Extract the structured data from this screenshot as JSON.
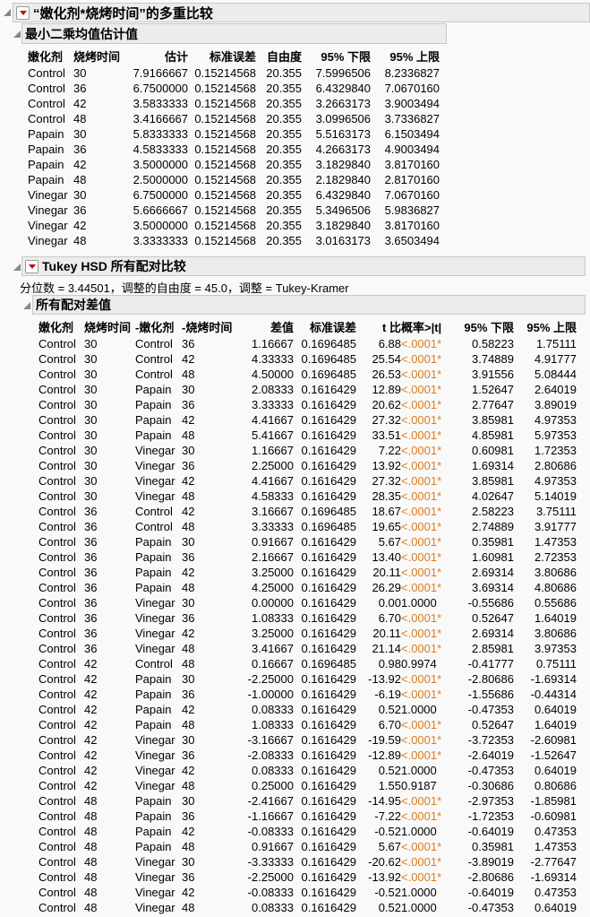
{
  "outline_title": "“嫩化剂*烧烤时间”的多重比较",
  "lsmeans": {
    "title": "最小二乘均值估计值",
    "headers": [
      "嫩化剂",
      "烧烤时间",
      "估计",
      "标准误差",
      "自由度",
      "95% 下限",
      "95% 上限"
    ],
    "rows": [
      [
        "Control",
        "30",
        "7.9166667",
        "0.15214568",
        "20.355",
        "7.5996506",
        "8.2336827"
      ],
      [
        "Control",
        "36",
        "6.7500000",
        "0.15214568",
        "20.355",
        "6.4329840",
        "7.0670160"
      ],
      [
        "Control",
        "42",
        "3.5833333",
        "0.15214568",
        "20.355",
        "3.2663173",
        "3.9003494"
      ],
      [
        "Control",
        "48",
        "3.4166667",
        "0.15214568",
        "20.355",
        "3.0996506",
        "3.7336827"
      ],
      [
        "Papain",
        "30",
        "5.8333333",
        "0.15214568",
        "20.355",
        "5.5163173",
        "6.1503494"
      ],
      [
        "Papain",
        "36",
        "4.5833333",
        "0.15214568",
        "20.355",
        "4.2663173",
        "4.9003494"
      ],
      [
        "Papain",
        "42",
        "3.5000000",
        "0.15214568",
        "20.355",
        "3.1829840",
        "3.8170160"
      ],
      [
        "Papain",
        "48",
        "2.5000000",
        "0.15214568",
        "20.355",
        "2.1829840",
        "2.8170160"
      ],
      [
        "Vinegar",
        "30",
        "6.7500000",
        "0.15214568",
        "20.355",
        "6.4329840",
        "7.0670160"
      ],
      [
        "Vinegar",
        "36",
        "5.6666667",
        "0.15214568",
        "20.355",
        "5.3496506",
        "5.9836827"
      ],
      [
        "Vinegar",
        "42",
        "3.5000000",
        "0.15214568",
        "20.355",
        "3.1829840",
        "3.8170160"
      ],
      [
        "Vinegar",
        "48",
        "3.3333333",
        "0.15214568",
        "20.355",
        "3.0163173",
        "3.6503494"
      ]
    ]
  },
  "tukey": {
    "title": "Tukey HSD 所有配对比较",
    "info": "分位数 = 3.44501，调整的自由度 = 45.0，调整 = Tukey-Kramer",
    "sub_title": "所有配对差值",
    "headers": [
      "嫩化剂",
      "烧烤时间",
      "-嫩化剂",
      "-烧烤时间",
      "差值",
      "标准误差",
      "t 比",
      "概率>|t|",
      "95% 下限",
      "95% 上限"
    ],
    "sig_color": "#e07b1e",
    "rows": [
      [
        "Control",
        "30",
        "Control",
        "36",
        "1.16667",
        "0.1696485",
        "6.88",
        "<.0001*",
        "0.58223",
        "1.75111"
      ],
      [
        "Control",
        "30",
        "Control",
        "42",
        "4.33333",
        "0.1696485",
        "25.54",
        "<.0001*",
        "3.74889",
        "4.91777"
      ],
      [
        "Control",
        "30",
        "Control",
        "48",
        "4.50000",
        "0.1696485",
        "26.53",
        "<.0001*",
        "3.91556",
        "5.08444"
      ],
      [
        "Control",
        "30",
        "Papain",
        "30",
        "2.08333",
        "0.1616429",
        "12.89",
        "<.0001*",
        "1.52647",
        "2.64019"
      ],
      [
        "Control",
        "30",
        "Papain",
        "36",
        "3.33333",
        "0.1616429",
        "20.62",
        "<.0001*",
        "2.77647",
        "3.89019"
      ],
      [
        "Control",
        "30",
        "Papain",
        "42",
        "4.41667",
        "0.1616429",
        "27.32",
        "<.0001*",
        "3.85981",
        "4.97353"
      ],
      [
        "Control",
        "30",
        "Papain",
        "48",
        "5.41667",
        "0.1616429",
        "33.51",
        "<.0001*",
        "4.85981",
        "5.97353"
      ],
      [
        "Control",
        "30",
        "Vinegar",
        "30",
        "1.16667",
        "0.1616429",
        "7.22",
        "<.0001*",
        "0.60981",
        "1.72353"
      ],
      [
        "Control",
        "30",
        "Vinegar",
        "36",
        "2.25000",
        "0.1616429",
        "13.92",
        "<.0001*",
        "1.69314",
        "2.80686"
      ],
      [
        "Control",
        "30",
        "Vinegar",
        "42",
        "4.41667",
        "0.1616429",
        "27.32",
        "<.0001*",
        "3.85981",
        "4.97353"
      ],
      [
        "Control",
        "30",
        "Vinegar",
        "48",
        "4.58333",
        "0.1616429",
        "28.35",
        "<.0001*",
        "4.02647",
        "5.14019"
      ],
      [
        "Control",
        "36",
        "Control",
        "42",
        "3.16667",
        "0.1696485",
        "18.67",
        "<.0001*",
        "2.58223",
        "3.75111"
      ],
      [
        "Control",
        "36",
        "Control",
        "48",
        "3.33333",
        "0.1696485",
        "19.65",
        "<.0001*",
        "2.74889",
        "3.91777"
      ],
      [
        "Control",
        "36",
        "Papain",
        "30",
        "0.91667",
        "0.1616429",
        "5.67",
        "<.0001*",
        "0.35981",
        "1.47353"
      ],
      [
        "Control",
        "36",
        "Papain",
        "36",
        "2.16667",
        "0.1616429",
        "13.40",
        "<.0001*",
        "1.60981",
        "2.72353"
      ],
      [
        "Control",
        "36",
        "Papain",
        "42",
        "3.25000",
        "0.1616429",
        "20.11",
        "<.0001*",
        "2.69314",
        "3.80686"
      ],
      [
        "Control",
        "36",
        "Papain",
        "48",
        "4.25000",
        "0.1616429",
        "26.29",
        "<.0001*",
        "3.69314",
        "4.80686"
      ],
      [
        "Control",
        "36",
        "Vinegar",
        "30",
        "0.00000",
        "0.1616429",
        "0.00",
        "1.0000",
        "-0.55686",
        "0.55686"
      ],
      [
        "Control",
        "36",
        "Vinegar",
        "36",
        "1.08333",
        "0.1616429",
        "6.70",
        "<.0001*",
        "0.52647",
        "1.64019"
      ],
      [
        "Control",
        "36",
        "Vinegar",
        "42",
        "3.25000",
        "0.1616429",
        "20.11",
        "<.0001*",
        "2.69314",
        "3.80686"
      ],
      [
        "Control",
        "36",
        "Vinegar",
        "48",
        "3.41667",
        "0.1616429",
        "21.14",
        "<.0001*",
        "2.85981",
        "3.97353"
      ],
      [
        "Control",
        "42",
        "Control",
        "48",
        "0.16667",
        "0.1696485",
        "0.98",
        "0.9974",
        "-0.41777",
        "0.75111"
      ],
      [
        "Control",
        "42",
        "Papain",
        "30",
        "-2.25000",
        "0.1616429",
        "-13.92",
        "<.0001*",
        "-2.80686",
        "-1.69314"
      ],
      [
        "Control",
        "42",
        "Papain",
        "36",
        "-1.00000",
        "0.1616429",
        "-6.19",
        "<.0001*",
        "-1.55686",
        "-0.44314"
      ],
      [
        "Control",
        "42",
        "Papain",
        "42",
        "0.08333",
        "0.1616429",
        "0.52",
        "1.0000",
        "-0.47353",
        "0.64019"
      ],
      [
        "Control",
        "42",
        "Papain",
        "48",
        "1.08333",
        "0.1616429",
        "6.70",
        "<.0001*",
        "0.52647",
        "1.64019"
      ],
      [
        "Control",
        "42",
        "Vinegar",
        "30",
        "-3.16667",
        "0.1616429",
        "-19.59",
        "<.0001*",
        "-3.72353",
        "-2.60981"
      ],
      [
        "Control",
        "42",
        "Vinegar",
        "36",
        "-2.08333",
        "0.1616429",
        "-12.89",
        "<.0001*",
        "-2.64019",
        "-1.52647"
      ],
      [
        "Control",
        "42",
        "Vinegar",
        "42",
        "0.08333",
        "0.1616429",
        "0.52",
        "1.0000",
        "-0.47353",
        "0.64019"
      ],
      [
        "Control",
        "42",
        "Vinegar",
        "48",
        "0.25000",
        "0.1616429",
        "1.55",
        "0.9187",
        "-0.30686",
        "0.80686"
      ],
      [
        "Control",
        "48",
        "Papain",
        "30",
        "-2.41667",
        "0.1616429",
        "-14.95",
        "<.0001*",
        "-2.97353",
        "-1.85981"
      ],
      [
        "Control",
        "48",
        "Papain",
        "36",
        "-1.16667",
        "0.1616429",
        "-7.22",
        "<.0001*",
        "-1.72353",
        "-0.60981"
      ],
      [
        "Control",
        "48",
        "Papain",
        "42",
        "-0.08333",
        "0.1616429",
        "-0.52",
        "1.0000",
        "-0.64019",
        "0.47353"
      ],
      [
        "Control",
        "48",
        "Papain",
        "48",
        "0.91667",
        "0.1616429",
        "5.67",
        "<.0001*",
        "0.35981",
        "1.47353"
      ],
      [
        "Control",
        "48",
        "Vinegar",
        "30",
        "-3.33333",
        "0.1616429",
        "-20.62",
        "<.0001*",
        "-3.89019",
        "-2.77647"
      ],
      [
        "Control",
        "48",
        "Vinegar",
        "36",
        "-2.25000",
        "0.1616429",
        "-13.92",
        "<.0001*",
        "-2.80686",
        "-1.69314"
      ],
      [
        "Control",
        "48",
        "Vinegar",
        "42",
        "-0.08333",
        "0.1616429",
        "-0.52",
        "1.0000",
        "-0.64019",
        "0.47353"
      ],
      [
        "Control",
        "48",
        "Vinegar",
        "48",
        "0.08333",
        "0.1616429",
        "0.52",
        "1.0000",
        "-0.47353",
        "0.64019"
      ]
    ]
  }
}
